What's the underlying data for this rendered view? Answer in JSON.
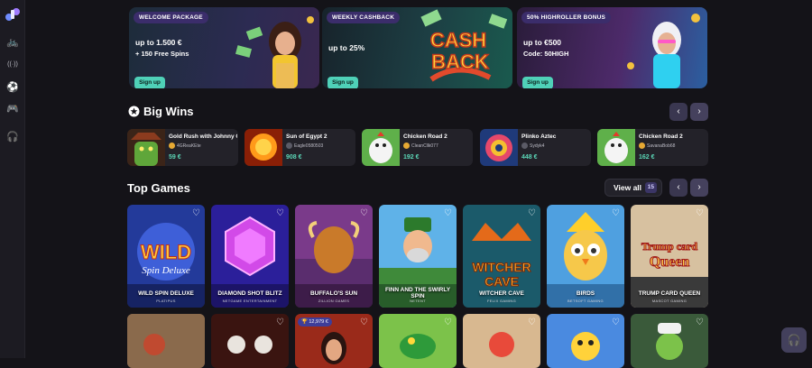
{
  "sidebar": {
    "items": [
      {
        "icon": "bicycle-icon",
        "glyph": "🚲"
      },
      {
        "icon": "broadcast-icon",
        "glyph": "((·))"
      },
      {
        "icon": "soccer-ball-icon",
        "glyph": "⚽"
      },
      {
        "icon": "gamepad-icon",
        "glyph": "🎮"
      },
      {
        "icon": "headset-icon",
        "glyph": "🎧"
      }
    ]
  },
  "banners": [
    {
      "tag": "WELCOME PACKAGE",
      "amount": "up to 1.500 €",
      "sub": "+ 150 Free Spins",
      "button": "Sign up"
    },
    {
      "tag": "WEEKLY CASHBACK",
      "amount": "up to 25%",
      "sub": "",
      "button": "Sign up",
      "art_text": [
        "CASH",
        "BACK"
      ]
    },
    {
      "tag": "50% HIGHROLLER BONUS",
      "amount": "up to €500",
      "sub": "Code: 50HIGH",
      "button": "Sign up"
    }
  ],
  "big_wins": {
    "title": "Big Wins",
    "prev": "‹",
    "next": "›",
    "items": [
      {
        "game": "Gold Rush with Johnny C",
        "user": "4GReaKEte",
        "amount": "59 €"
      },
      {
        "game": "Sun of Egypt 2",
        "user": "Eagle0580503",
        "amount": "908 €"
      },
      {
        "game": "Chicken Road 2",
        "user": "CleanCllk077",
        "amount": "192 €"
      },
      {
        "game": "Plinko Aztec",
        "user": "Sydyk4",
        "amount": "448 €"
      },
      {
        "game": "Chicken Road 2",
        "user": "SavanaBob68",
        "amount": "162 €"
      }
    ]
  },
  "top_games": {
    "title": "Top Games",
    "view_all": "View all",
    "count": "15",
    "prev": "‹",
    "next": "›",
    "cards": [
      {
        "title": "WILD SPIN DELUXE",
        "provider": "PLATIPUS",
        "art": [
          "WILD",
          "Spin Deluxe"
        ]
      },
      {
        "title": "DIAMOND SHOT BLITZ",
        "provider": "NETGAME ENTERTAINMENT",
        "art": []
      },
      {
        "title": "BUFFALO'S SUN",
        "provider": "ZILLION GAMES",
        "art": []
      },
      {
        "title": "FINN AND THE SWIRLY SPIN",
        "provider": "NETENT",
        "art": []
      },
      {
        "title": "WITCHER CAVE",
        "provider": "FELIX GAMING",
        "art": [
          "WITCHER",
          "CAVE"
        ]
      },
      {
        "title": "BIRDS",
        "provider": "BETSOFT GAMING",
        "art": []
      },
      {
        "title": "TRUMP CARD QUEEN",
        "provider": "MASCOT GAMING",
        "art": [
          "Trump card",
          "Queen"
        ]
      }
    ],
    "row2_jackpot": "🏆 12,979 €"
  },
  "support": {
    "icon": "headset-icon",
    "glyph": "🎧"
  },
  "colors": {
    "accent": "#4fd1b8",
    "win_amount": "#5bd7b7",
    "nav": "#3a3750"
  }
}
